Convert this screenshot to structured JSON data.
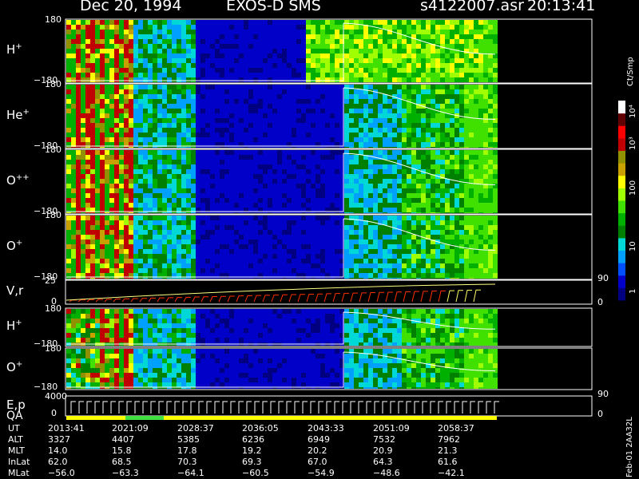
{
  "header": {
    "date": "Dec 20, 1994",
    "mission": "EXOS-D SMS",
    "file": "s4122007.asr",
    "time": "20:13:41"
  },
  "panels": [
    {
      "label": "H",
      "sup": "+",
      "top": "180",
      "bottom": "−180"
    },
    {
      "label": "He",
      "sup": "+",
      "top": "180",
      "bottom": "−180"
    },
    {
      "label": "O",
      "sup": "++",
      "top": "180",
      "bottom": "−180"
    },
    {
      "label": "O",
      "sup": "+",
      "top": "180",
      "bottom": "−180"
    },
    {
      "label": "V,r",
      "sup": "",
      "top": "25",
      "bottom": "0",
      "right_top": "90",
      "right_bottom": "0"
    },
    {
      "label": "H",
      "sup": "+",
      "top": "180",
      "bottom": "−180"
    },
    {
      "label": "O",
      "sup": "+",
      "top": "180",
      "bottom": "−180"
    },
    {
      "label": "E,p",
      "sup": "",
      "top": "4000",
      "bottom": "0",
      "right_top": "90",
      "right_bottom": "0"
    }
  ],
  "qa_label": "QA",
  "colorbar": {
    "unit": "Ct/Smp",
    "ticks": [
      "1",
      "10",
      "100",
      "10³",
      "10⁴"
    ],
    "colors": [
      "#000080",
      "#0000c8",
      "#0050ff",
      "#00a0ff",
      "#00d8d8",
      "#008000",
      "#00b000",
      "#40e000",
      "#a0ff00",
      "#ffff00",
      "#c8a000",
      "#909000",
      "#c00000",
      "#ff0000",
      "#600000",
      "#ffffff"
    ]
  },
  "table": {
    "rows": [
      {
        "name": "UT",
        "values": [
          "2013:41",
          "2021:09",
          "2028:37",
          "2036:05",
          "2043:33",
          "2051:09",
          "2058:37"
        ]
      },
      {
        "name": "ALT",
        "values": [
          "3327",
          "4407",
          "5385",
          "6236",
          "6949",
          "7532",
          "7962"
        ]
      },
      {
        "name": "MLT",
        "values": [
          "14.0",
          "15.8",
          "17.8",
          "19.2",
          "20.2",
          "20.9",
          "21.3"
        ]
      },
      {
        "name": "InLat",
        "values": [
          "62.0",
          "68.5",
          "70.3",
          "69.3",
          "67.0",
          "64.3",
          "61.6"
        ]
      },
      {
        "name": "MLat",
        "values": [
          "−56.0",
          "−63.3",
          "−64.1",
          "−60.5",
          "−54.9",
          "−48.6",
          "−42.1"
        ]
      }
    ]
  },
  "footer": "Feb-01 2AA32L",
  "chart_data": {
    "type": "heatmap",
    "title": "Dec 20, 1994   EXOS-D SMS",
    "x_ticks": [
      "2013:41",
      "2021:09",
      "2028:37",
      "2036:05",
      "2043:33",
      "2051:09",
      "2058:37"
    ],
    "ylim_pitch": [
      -180,
      180
    ],
    "ylim_velocity": [
      0,
      25
    ],
    "ylim_energy": [
      0,
      4000
    ],
    "zscale": "log",
    "zlim": [
      1,
      10000
    ],
    "zlabel": "Ct/Smp"
  }
}
